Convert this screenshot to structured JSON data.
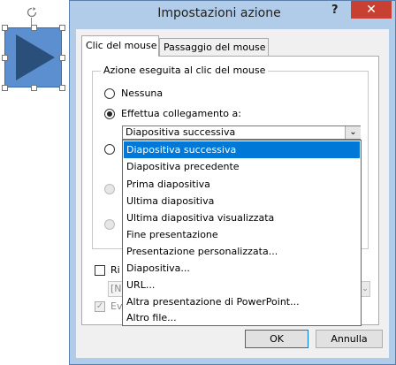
{
  "dialog": {
    "title": "Impostazioni azione",
    "help_label": "?",
    "close_label": "✕"
  },
  "tabs": [
    {
      "label": "Clic del mouse",
      "active": true
    },
    {
      "label": "Passaggio del mouse",
      "active": false
    }
  ],
  "group": {
    "legend": "Azione eseguita al clic del mouse",
    "options": [
      {
        "label": "Nessuna",
        "checked": false
      },
      {
        "label": "Effettua collegamento a:",
        "checked": true
      }
    ]
  },
  "hyperlink_combo": {
    "value": "Diapositiva successiva",
    "items": [
      "Diapositiva successiva",
      "Diapositiva precedente",
      "Prima diapositiva",
      "Ultima diapositiva",
      "Ultima diapositiva visualizzata",
      "Fine presentazione",
      "Presentazione personalizzata...",
      "Diapositiva...",
      "URL...",
      "Altra presentazione di PowerPoint...",
      "Altro file..."
    ],
    "selected_index": 0
  },
  "partial": {
    "play_sound_label_fragment": "Ri",
    "sound_field_fragment": "[N",
    "highlight_label_fragment": "Ev"
  },
  "buttons": {
    "ok": "OK",
    "cancel": "Annulla"
  },
  "colors": {
    "selection": "#0078d7",
    "dialog_frame": "#b1cce8",
    "close_button": "#c84031",
    "shape_fill": "#5b8fd0"
  }
}
